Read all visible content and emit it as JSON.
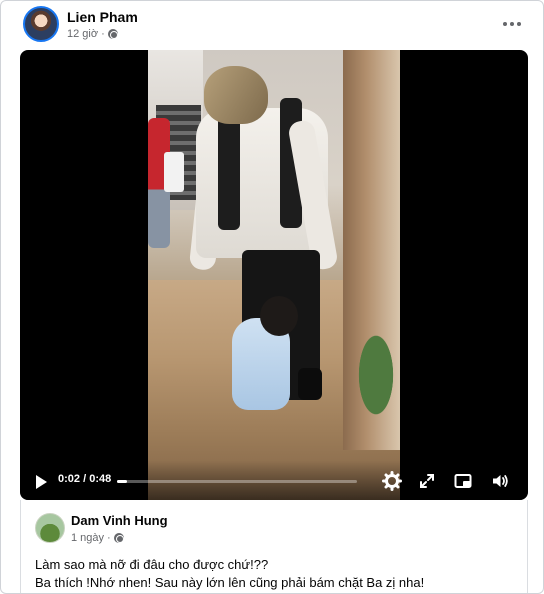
{
  "post": {
    "author": "Lien Pham",
    "time": "12 giờ",
    "privacy_icon": "globe-icon",
    "more_icon": "ellipsis-icon"
  },
  "video": {
    "current_time": "0:02",
    "separator": "/",
    "duration": "0:48",
    "progress": 0.04,
    "controls": [
      "play-icon",
      "settings-gear-icon",
      "fullscreen-icon",
      "picture-in-picture-icon",
      "volume-icon"
    ]
  },
  "comment": {
    "author": "Dam Vinh Hung",
    "time": "1 ngày",
    "privacy_icon": "globe-icon",
    "lines": [
      "Làm sao mà nỡ đi đâu cho được chứ!??",
      "Ba thích !Nhớ nhen! Sau này lớn lên cũng phải bám chặt Ba zị nha!"
    ]
  },
  "colors": {
    "accent": "#1877f2",
    "secondary_text": "#65676b"
  }
}
